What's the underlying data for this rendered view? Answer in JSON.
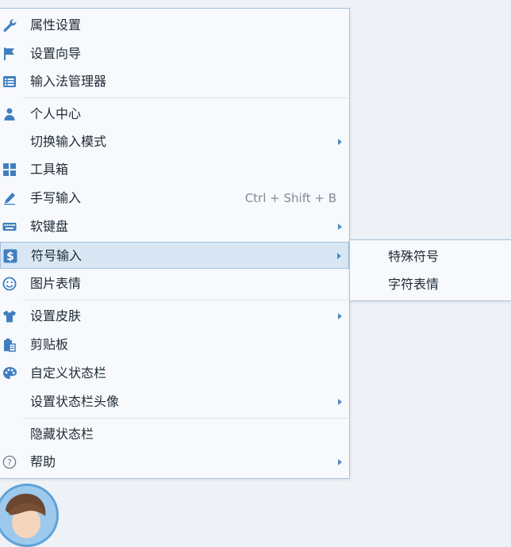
{
  "menu": {
    "items": [
      {
        "label": "属性设置",
        "icon": "wrench-icon"
      },
      {
        "label": "设置向导",
        "icon": "flag-icon"
      },
      {
        "label": "输入法管理器",
        "icon": "list-icon"
      },
      {
        "label": "个人中心",
        "icon": "person-icon"
      },
      {
        "label": "切换输入模式",
        "icon": "",
        "submenu": true
      },
      {
        "label": "工具箱",
        "icon": "grid-icon"
      },
      {
        "label": "手写输入",
        "icon": "pen-icon",
        "shortcut": "Ctrl + Shift + B"
      },
      {
        "label": "软键盘",
        "icon": "keyboard-icon",
        "submenu": true
      },
      {
        "label": "符号输入",
        "icon": "dollar-icon",
        "submenu": true,
        "active": true
      },
      {
        "label": "图片表情",
        "icon": "smiley-icon"
      },
      {
        "label": "设置皮肤",
        "icon": "shirt-icon",
        "submenu": true
      },
      {
        "label": "剪贴板",
        "icon": "clipboard-icon"
      },
      {
        "label": "自定义状态栏",
        "icon": "palette-icon"
      },
      {
        "label": "设置状态栏头像",
        "icon": "",
        "submenu": true
      },
      {
        "label": "隐藏状态栏",
        "icon": ""
      },
      {
        "label": "帮助",
        "icon": "help-icon",
        "submenu": true
      }
    ]
  },
  "submenu": {
    "items": [
      {
        "label": "特殊符号"
      },
      {
        "label": "字符表情"
      }
    ]
  },
  "colors": {
    "icon": "#3f7fc0",
    "arrow": "#4f8cc7",
    "highlight": "#d9e7f5",
    "border": "#aac3da"
  }
}
